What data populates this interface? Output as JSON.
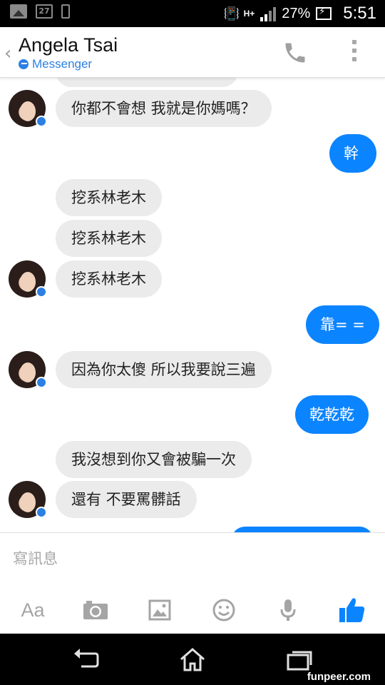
{
  "status_bar": {
    "calendar_day": "27",
    "network": "H+",
    "battery": "27%",
    "time": "5:51"
  },
  "header": {
    "title": "Angela Tsai",
    "subtitle": "Messenger"
  },
  "messages": [
    {
      "side": "in",
      "text": "你都不會想 我就是你媽嗎？"
    },
    {
      "side": "out",
      "text": "幹"
    },
    {
      "side": "in",
      "text": "挖系林老木"
    },
    {
      "side": "in",
      "text": "挖系林老木"
    },
    {
      "side": "in",
      "text": "挖系林老木"
    },
    {
      "side": "out",
      "text": "靠= ="
    },
    {
      "side": "in",
      "text": "因為你太傻 所以我要說三遍"
    },
    {
      "side": "out",
      "text": "乾乾乾"
    },
    {
      "side": "in",
      "text": "我沒想到你又會被騙一次"
    },
    {
      "side": "in",
      "text": "還有 不要罵髒話"
    }
  ],
  "composer": {
    "placeholder": "寫訊息",
    "text_tool_label": "Aa"
  },
  "colors": {
    "accent": "#0b84ff",
    "incoming_bubble": "#ebebeb",
    "messenger_blue": "#2c7fe3"
  },
  "watermark": "funpeer.com"
}
